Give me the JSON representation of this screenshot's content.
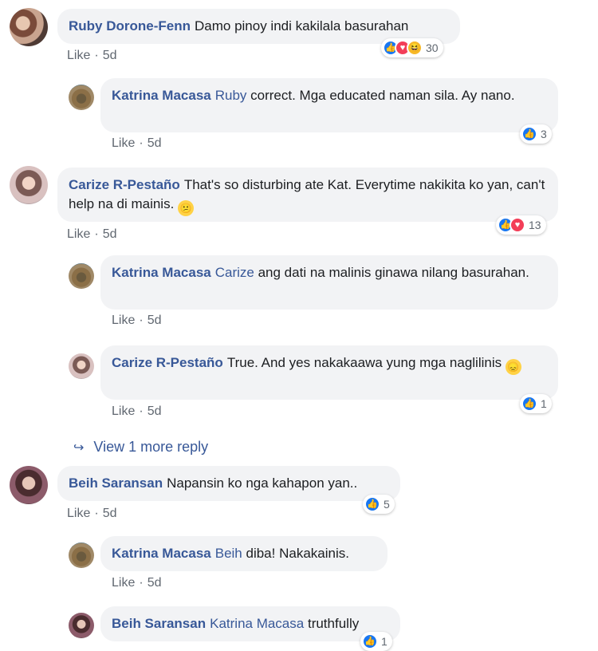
{
  "comments": [
    {
      "author": "Ruby Dorone-Fenn",
      "text": "Damo pinoy indi kakilala basurahan",
      "like": "Like",
      "time": "5d",
      "reaction_count": "30"
    },
    {
      "author": "Katrina Macasa",
      "mention": "Ruby",
      "text": "correct. Mga educated naman sila. Ay nano.",
      "like": "Like",
      "time": "5d",
      "reaction_count": "3"
    },
    {
      "author": "Carize R-Pestaño",
      "text": "That's so disturbing ate Kat. Everytime nakikita ko yan, can't help na di mainis.",
      "like": "Like",
      "time": "5d",
      "reaction_count": "13"
    },
    {
      "author": "Katrina Macasa",
      "mention": "Carize",
      "text": "ang dati na malinis ginawa nilang basurahan.",
      "like": "Like",
      "time": "5d"
    },
    {
      "author": "Carize R-Pestaño",
      "text": "True. And yes nakakaawa yung mga naglilinis",
      "like": "Like",
      "time": "5d",
      "reaction_count": "1"
    },
    {
      "author": "Beih Saransan",
      "text": "Napansin ko nga kahapon yan..",
      "like": "Like",
      "time": "5d",
      "reaction_count": "5"
    },
    {
      "author": "Katrina Macasa",
      "mention": "Beih",
      "text": "diba! Nakakainis.",
      "like": "Like",
      "time": "5d"
    },
    {
      "author": "Beih Saransan",
      "mention": "Katrina Macasa",
      "text": "truthfully",
      "reaction_count": "1"
    }
  ],
  "more_replies": "View 1 more reply",
  "colors": {
    "link": "#385898",
    "bubble": "#f2f3f5",
    "like_blue": "#1877f2",
    "love_red": "#f33e58"
  }
}
